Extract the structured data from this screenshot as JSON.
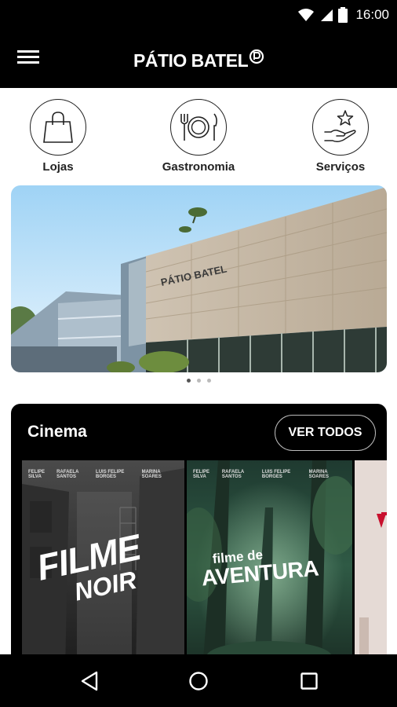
{
  "status_bar": {
    "time": "16:00"
  },
  "app_bar": {
    "logo_text": "PÁTIO BATEL"
  },
  "categories": [
    {
      "label": "Lojas",
      "icon": "shopping-bag-icon"
    },
    {
      "label": "Gastronomia",
      "icon": "plate-cutlery-icon"
    },
    {
      "label": "Serviços",
      "icon": "star-hand-icon"
    }
  ],
  "hero": {
    "sign_text": "PÁTIO BATEL",
    "slides": 3,
    "active_slide": 1
  },
  "cinema": {
    "title": "Cinema",
    "see_all_label": "VER TODOS",
    "posters": [
      {
        "title_line1": "FILME",
        "title_line2": "NOIR",
        "credits": [
          "FELIPE SILVA",
          "RAFAELA SANTOS",
          "LUIS FELIPE BORGES",
          "MARINA SOARES"
        ]
      },
      {
        "title_line1": "filme de",
        "title_line2": "AVENTURA",
        "credits": [
          "FELIPE SILVA",
          "RAFAELA SANTOS",
          "LUIS FELIPE BORGES",
          "MARINA SOARES"
        ]
      }
    ]
  },
  "colors": {
    "bar_bg": "#000000",
    "text_dark": "#222222",
    "accent_red": "#c8102e"
  }
}
